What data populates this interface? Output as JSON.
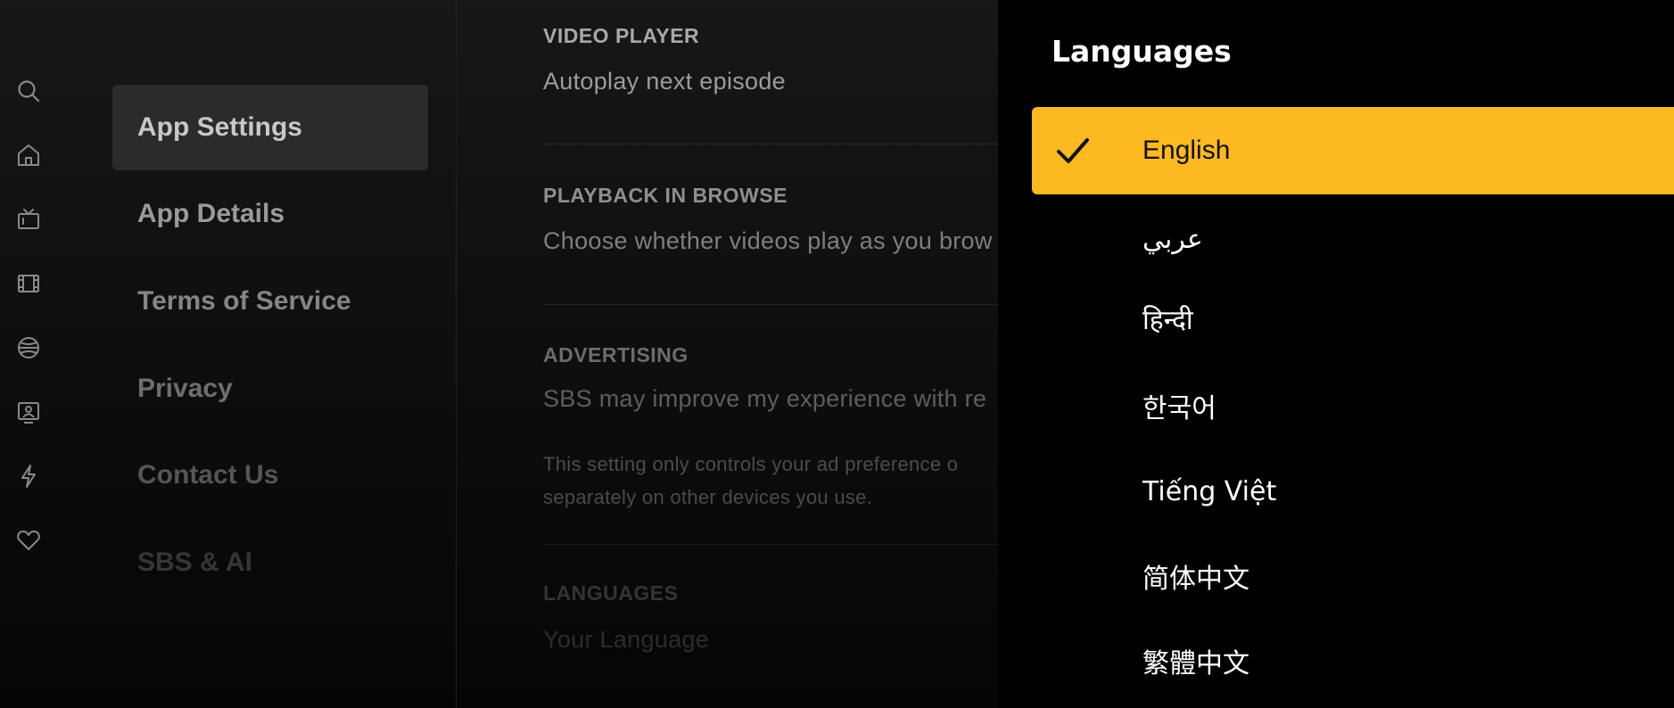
{
  "rail": {
    "icons": [
      "search-icon",
      "home-icon",
      "tv-icon",
      "film-icon",
      "sport-icon",
      "presenter-icon",
      "lightning-icon",
      "heart-icon"
    ]
  },
  "menu": {
    "items": [
      {
        "label": "App Settings",
        "active": true
      },
      {
        "label": "App Details",
        "active": false
      },
      {
        "label": "Terms of Service",
        "active": false
      },
      {
        "label": "Privacy",
        "active": false
      },
      {
        "label": "Contact Us",
        "active": false
      },
      {
        "label": "SBS & AI",
        "active": false
      }
    ]
  },
  "settings": {
    "video_player": {
      "title": "VIDEO PLAYER",
      "desc": "Autoplay next episode"
    },
    "playback_in_browse": {
      "title": "PLAYBACK IN BROWSE",
      "desc": "Choose whether videos play as you brow"
    },
    "advertising": {
      "title": "ADVERTISING",
      "desc": "SBS may improve my experience with re",
      "note_line1": "This setting only controls your ad preference o",
      "note_line2": "separately on other devices you use."
    },
    "languages": {
      "title": "LANGUAGES",
      "desc": "Your Language"
    }
  },
  "languages_panel": {
    "title": "Languages",
    "selected": "English",
    "options": [
      "English",
      "عربي",
      "हिन्दी",
      "한국어",
      "Tiếng Việt",
      "简体中文",
      "繁體中文"
    ]
  },
  "colors": {
    "accent": "#fdb920",
    "panel_bg": "#000000",
    "menu_active_bg": "#2a2b2d"
  }
}
